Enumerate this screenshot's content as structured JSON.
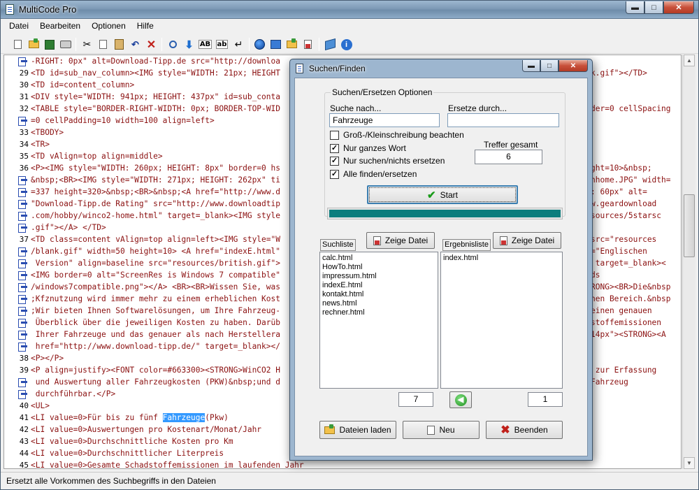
{
  "window": {
    "title": "MultiCode Pro"
  },
  "menu": [
    "Datei",
    "Bearbeiten",
    "Optionen",
    "Hilfe"
  ],
  "toolbar": {
    "bold_label": "AB",
    "small_label": "ab",
    "icons": [
      "new-file-icon",
      "open-folder-icon",
      "save-icon",
      "print-icon",
      "cut-icon",
      "copy-icon",
      "paste-icon",
      "undo-icon",
      "delete-icon",
      "find-icon",
      "replace-down-icon",
      "uppercase-icon",
      "lowercase-icon",
      "enter-icon",
      "globe-icon",
      "browser-preview-icon",
      "folder-upload-icon",
      "notes-icon",
      "book-icon",
      "info-icon"
    ]
  },
  "editor": {
    "lines": [
      {
        "n": "",
        "t": "-RIGHT: 0px\" alt=Download-Tipp.de src=\"http://downloa"
      },
      {
        "n": "29",
        "t": "<TD id=sub_nav_column><IMG style=\"WIDTH: 21px; HEIGHT",
        "tail": "k.gif\"></TD>"
      },
      {
        "n": "30",
        "t": "<TD id=content_column>"
      },
      {
        "n": "31",
        "t": "<DIV style=\"WIDTH: 941px; HEIGHT: 437px\" id=sub_conta"
      },
      {
        "n": "32",
        "t": "<TABLE style=\"BORDER-RIGHT-WIDTH: 0px; BORDER-TOP-WID",
        "tail": "der=0 cellSpacing"
      },
      {
        "n": "",
        "t": "=0 cellPadding=10 width=100 align=left>"
      },
      {
        "n": "33",
        "t": "<TBODY>"
      },
      {
        "n": "34",
        "t": "<TR>"
      },
      {
        "n": "35",
        "t": "<TD vAlign=top align=middle>"
      },
      {
        "n": "36",
        "t": "<P><IMG style=\"WIDTH: 260px; HEIGHT: 8px\" border=0 hs",
        "tail": "ght=10>&nbsp;"
      },
      {
        "n": "",
        "t": "&nbsp;<BR><IMG style=\"WIDTH: 271px; HEIGHT: 262px\" ti",
        "tail": "nhome.JPG\" width="
      },
      {
        "n": "",
        "t": "=337 height=320>&nbsp;<BR>&nbsp;<A href=\"http://www.d",
        "tail": ": 60px\" alt="
      },
      {
        "n": "",
        "t": "\"Download-Tipp.de Rating\" src=\"http://www.downloadtip",
        "tail": "w.geardownload"
      },
      {
        "n": "",
        "t": ".com/hobby/winco2-home.html\" target=_blank><IMG style",
        "tail": "sources/5starsc"
      },
      {
        "n": "",
        "t": ".gif\"></A> </TD>"
      },
      {
        "n": "37",
        "t": "<TD class=content vAlign=top align=left><IMG style=\"W",
        "tail": "src=\"resources"
      },
      {
        "n": "",
        "t": "/blank.gif\" width=50 height=10> <A href=\"indexE.html\"",
        "tail": "=\"Englischen"
      },
      {
        "n": "",
        "t": " Version\" align=baseline src=\"resources/british.gif\">",
        "tail": " target=_blank><"
      },
      {
        "n": "",
        "t": "<IMG border=0 alt=\"ScreenRes is Windows 7 compatible\"",
        "tail": "ds"
      },
      {
        "n": "",
        "t": "/windows7compatible.png\"></A> <BR><BR>Wissen Sie, was",
        "tail": "RONG><BR>Die&nbsp"
      },
      {
        "n": "",
        "t": ";Kfznutzung wird immer mehr zu einem erheblichen Kost",
        "tail": "hen Bereich.&nbsp"
      },
      {
        "n": "",
        "t": ";Wir bieten Ihnen Softwarelösungen, um Ihre Fahrzeug-",
        "tail": "einen genauen"
      },
      {
        "n": "",
        "t": " Überblick über die jeweiligen Kosten zu haben. Darüb",
        "tail": "stoffemissionen"
      },
      {
        "n": "",
        "t": " Ihrer Fahrzeuge und das genauer als nach Herstellera",
        "tail": "14px\"><STRONG><A"
      },
      {
        "n": "",
        "t": " href=\"http://www.download-tipp.de/\" target=_blank></"
      },
      {
        "n": "38",
        "t": "<P></P>"
      },
      {
        "n": "39",
        "t": "<P align=justify><FONT color=#663300><STRONG>WinCO2 H",
        "tail": " zur Erfassung"
      },
      {
        "n": "",
        "t": " und Auswertung aller Fahrzeugkosten (PKW)&nbsp;und d",
        "tail": "Fahrzeug"
      },
      {
        "n": "",
        "t": " durchführbar.</P>"
      },
      {
        "n": "40",
        "t": "<UL>"
      },
      {
        "n": "41",
        "t": "<LI value=0>Für bis zu fünf ",
        "hl": "Fahrzeuge",
        "after": "(Pkw)"
      },
      {
        "n": "42",
        "t": "<LI value=0>Auswertungen pro Kostenart/Monat/Jahr"
      },
      {
        "n": "43",
        "t": "<LI value=0>Durchschnittliche Kosten pro Km"
      },
      {
        "n": "44",
        "t": "<LI value=0>Durchschnittlicher Literpreis"
      },
      {
        "n": "45",
        "t": "<LI value=0>Gesamte Schadstoffemissionen im laufenden Jahr"
      }
    ]
  },
  "status": {
    "text": "Ersetzt alle Vorkommen des Suchbegriffs in den Dateien"
  },
  "dialog": {
    "title": "Suchen/Finden",
    "group_label": "Suchen/Ersetzen Optionen",
    "search_label": "Suche nach...",
    "search_value": "Fahrzeuge",
    "replace_label": "Ersetze durch...",
    "replace_value": "",
    "options": [
      {
        "label": "Groß-/Kleinschreibung beachten",
        "checked": false
      },
      {
        "label": "Nur ganzes Wort",
        "checked": true
      },
      {
        "label": "Nur suchen/nichts ersetzen",
        "checked": true
      },
      {
        "label": "Alle finden/ersetzen",
        "checked": true
      }
    ],
    "hits_label": "Treffer gesamt",
    "hits_value": "6",
    "start_label": "Start",
    "progress": 1.0,
    "search_list_label": "Suchliste",
    "show_file_label": "Zeige Datei",
    "result_list_label": "Ergebnisliste",
    "search_list": [
      "calc.html",
      "HowTo.html",
      "impressum.html",
      "indexE.html",
      "kontakt.html",
      "news.html",
      "rechner.html"
    ],
    "result_list": [
      "index.html"
    ],
    "search_count": "7",
    "result_count": "1",
    "load_label": "Dateien laden",
    "new_label": "Neu",
    "quit_label": "Beenden"
  }
}
